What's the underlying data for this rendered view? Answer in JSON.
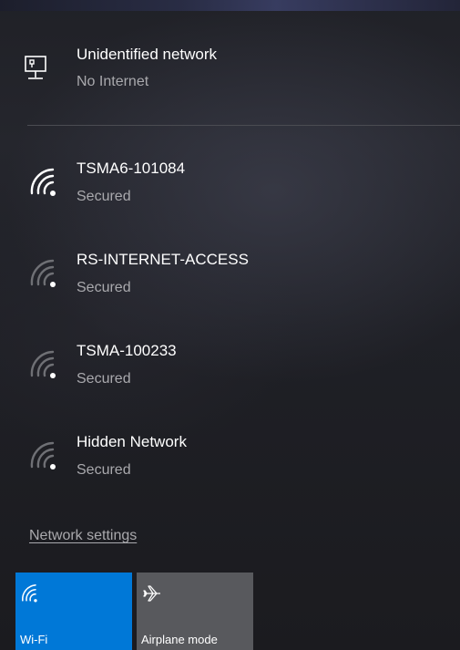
{
  "current_connection": {
    "icon": "wired-network-icon",
    "name": "Unidentified network",
    "status": "No Internet"
  },
  "networks": [
    {
      "ssid": "TSMA6-101084",
      "security": "Secured",
      "icon": "wifi-signal-icon",
      "signal_bars": 4
    },
    {
      "ssid": "RS-INTERNET-ACCESS",
      "security": "Secured",
      "icon": "wifi-signal-icon",
      "signal_bars": 1
    },
    {
      "ssid": "TSMA-100233",
      "security": "Secured",
      "icon": "wifi-signal-icon",
      "signal_bars": 1
    },
    {
      "ssid": "Hidden Network",
      "security": "Secured",
      "icon": "wifi-signal-icon",
      "signal_bars": 1
    }
  ],
  "settings_link": "Network settings",
  "quick_actions": {
    "wifi": {
      "label": "Wi-Fi",
      "icon": "wifi-icon",
      "active": true
    },
    "airplane": {
      "label": "Airplane mode",
      "icon": "airplane-icon",
      "active": false
    }
  },
  "colors": {
    "accent": "#0078d7",
    "tile_inactive": "#58595d",
    "primary_text": "#ffffff",
    "secondary_text": "#a9a9ad",
    "signal_full": "#ffffff",
    "signal_dim": "#6f7075"
  }
}
